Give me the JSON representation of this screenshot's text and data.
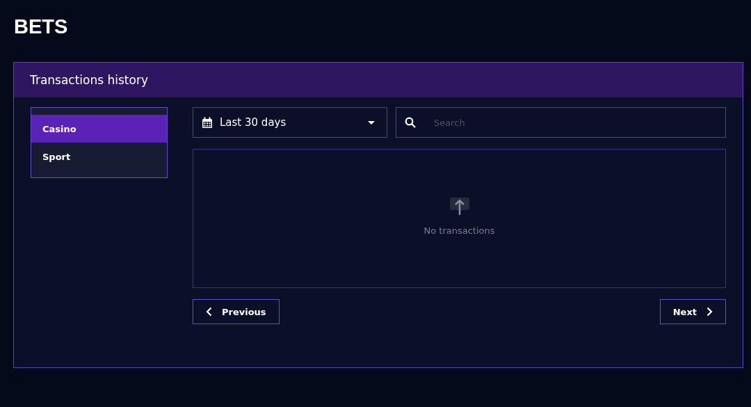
{
  "page_title": "BETS",
  "panel": {
    "title": "Transactions history"
  },
  "categories": [
    {
      "label": "Casino",
      "selected": true
    },
    {
      "label": "Sport",
      "selected": false
    }
  ],
  "period_dropdown": {
    "value": "Last 30 days"
  },
  "search": {
    "placeholder": "Search"
  },
  "empty_state": {
    "message": "No transactions"
  },
  "pagination": {
    "previous": "Previous",
    "next": "Next"
  }
}
